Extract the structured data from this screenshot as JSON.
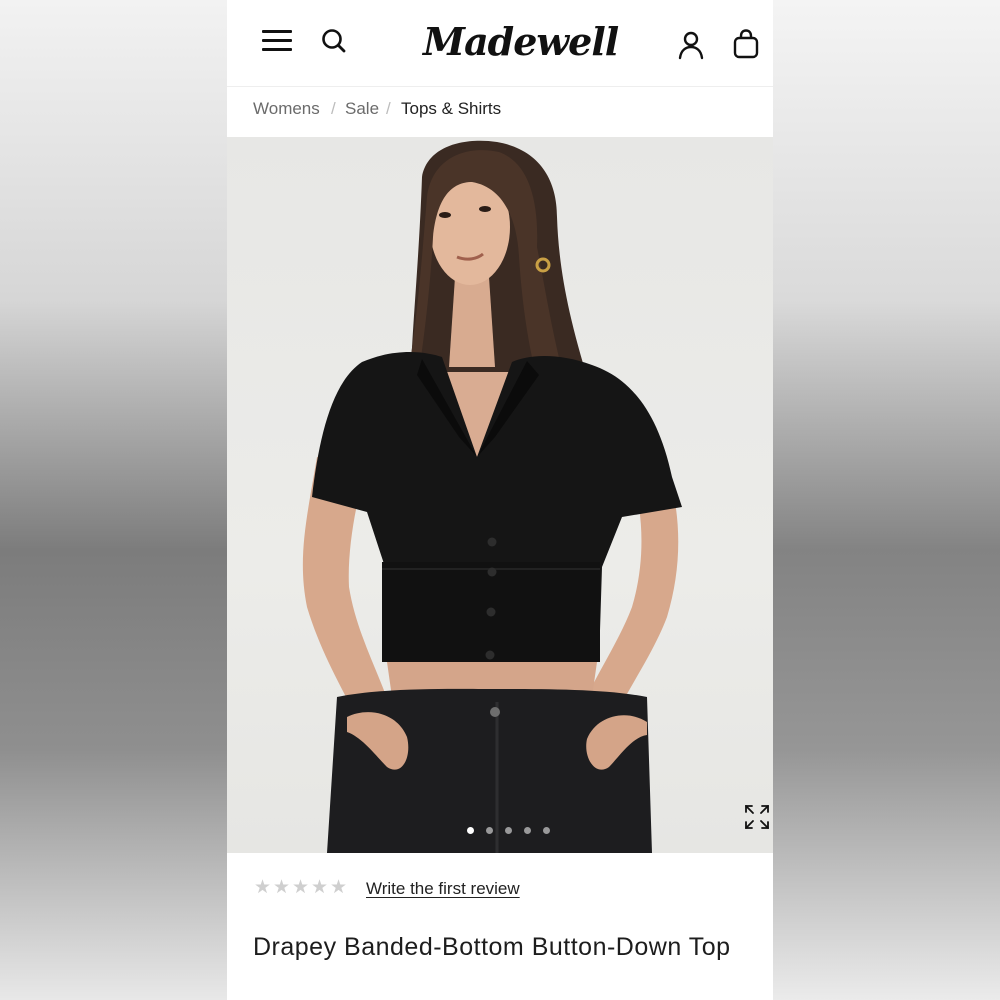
{
  "header": {
    "logo_text": "Madewell",
    "menu_icon": "hamburger-menu-icon",
    "search_icon": "search-icon",
    "account_icon": "user-account-icon",
    "bag_icon": "shopping-bag-icon"
  },
  "breadcrumb": {
    "items": [
      "Womens",
      "Sale",
      "Tops & Shirts"
    ],
    "separator": "/"
  },
  "gallery": {
    "image_count": 5,
    "active_index": 0,
    "expand_icon": "expand-icon"
  },
  "product": {
    "rating_stars": 0,
    "rating_max": 5,
    "review_link": "Write the first review",
    "title": "Drapey Banded-Bottom Button-Down Top"
  },
  "colors": {
    "text": "#1d1d1d",
    "muted": "#6b6b6b",
    "star_empty": "#cfcfcf",
    "garment": "#151515"
  }
}
